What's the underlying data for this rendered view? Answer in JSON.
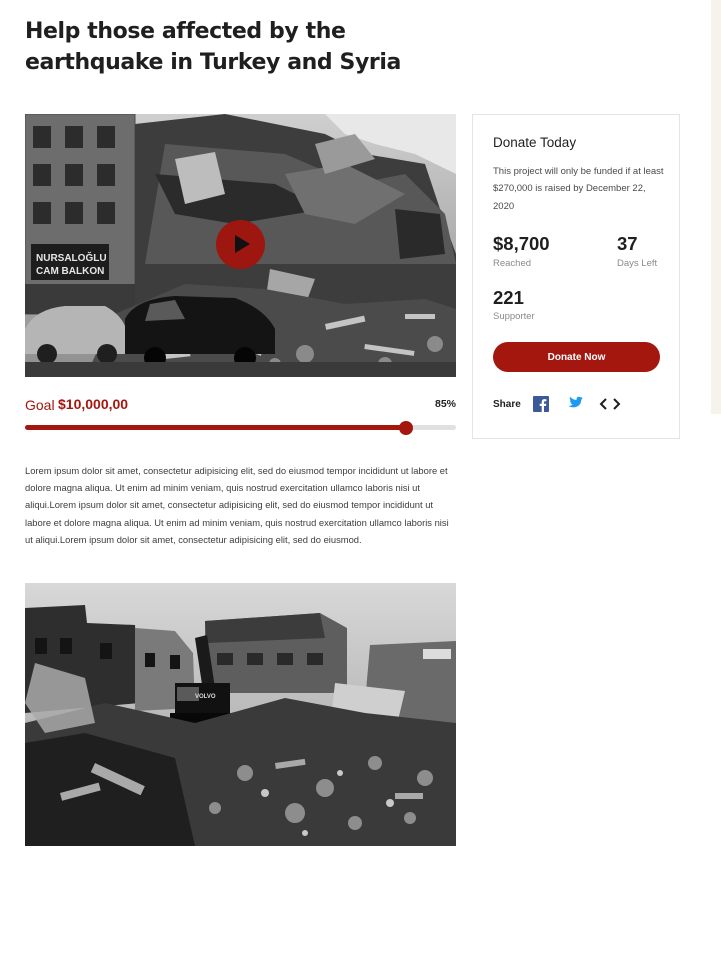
{
  "page": {
    "title_line1": "Help those affected by the",
    "title_line2": "earthquake in Turkey and Syria"
  },
  "campaign": {
    "goal_label": "Goal",
    "goal_amount": "$10,000,00",
    "progress_percent_text": "85%",
    "progress_fraction": 0.885,
    "description": "Lorem ipsum dolor sit amet, consectetur adipisicing elit, sed do eiusmod tempor incididunt ut labore et dolore magna aliqua. Ut enim ad minim veniam, quis nostrud exercitation ullamco laboris nisi ut aliqui.Lorem ipsum dolor sit amet, consectetur adipisicing elit, sed do eiusmod tempor incididunt ut labore et dolore magna aliqua. Ut enim ad minim veniam, quis nostrud exercitation ullamco laboris nisi ut aliqui.Lorem ipsum dolor sit amet, consectetur adipisicing elit, sed do eiusmod."
  },
  "donate_card": {
    "title": "Donate Today",
    "note": "This project will only be funded if at least $270,000 is raised by December 22, 2020",
    "reached_value": "$8,700",
    "reached_label": "Reached",
    "days_value": "37",
    "days_label": "Days Left",
    "supporter_value": "221",
    "supporter_label": "Supporter",
    "button_label": "Donate Now",
    "share_label": "Share"
  },
  "icons": {
    "play": "play-icon",
    "facebook": "facebook-icon",
    "twitter": "twitter-icon",
    "embed": "embed-code-icon"
  },
  "colors": {
    "accent": "#a3170f",
    "facebook": "#3b5998",
    "twitter": "#1d9bf0",
    "track": "#e1e1e1"
  }
}
